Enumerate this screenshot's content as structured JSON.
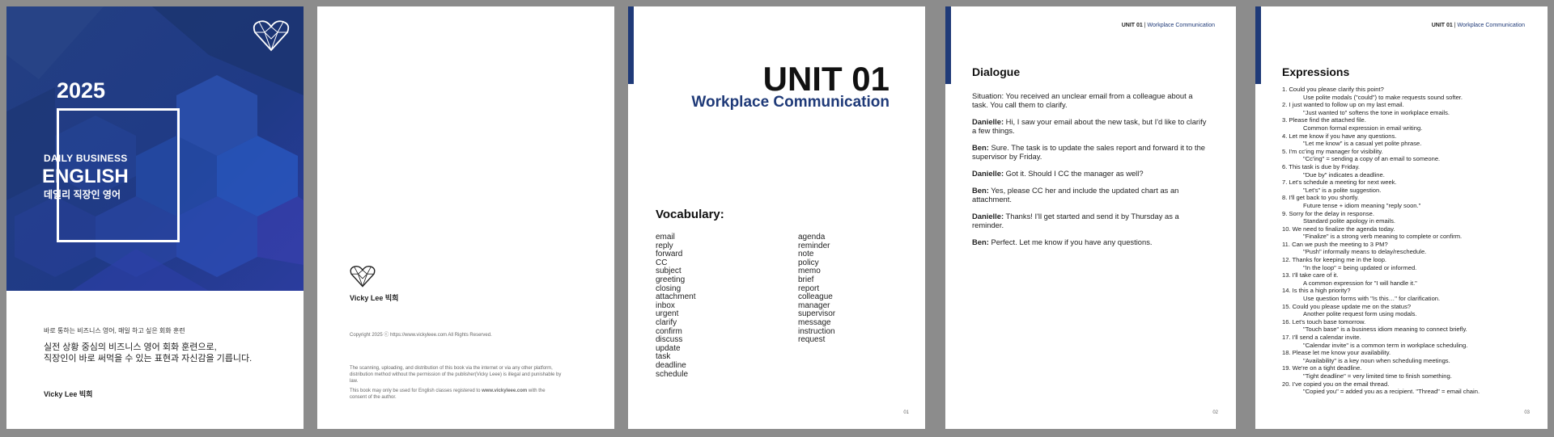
{
  "cover": {
    "year": "2025",
    "subtitle": "DAILY BUSINESS",
    "title": "ENGLISH",
    "title_ko": "데일리 직장인 영어",
    "tagline": "바로 통하는 비즈니스 영어, 매일 하고 싶은 회화 훈련",
    "desc_line1": "실전 상황 중심의 비즈니스 영어 회화 훈련으로,",
    "desc_line2": "직장인이 바로 써먹을 수 있는 표현과 자신감을 기릅니다.",
    "author": "Vicky Lee 빅희",
    "accent": "#1f3a78"
  },
  "copyright_page": {
    "author": "Vicky Lee 빅희",
    "copyright": "Copyright 2025 ⓒ https://www.vickyleee.com All Rights Reserved.",
    "legal": "The scanning, uploading, and distribution of this book via the internet or via any other platform, distribution method without the permission of the publisher(Vicky Leee) is illegal and punishable by law.",
    "note_prefix": "This book may only be used for English classes registered to ",
    "note_site": "www.vickyleee.com",
    "note_suffix": " with the consent of the author."
  },
  "unit_page": {
    "unit": "UNIT 01",
    "subtitle": "Workplace Communication",
    "vocab_heading": "Vocabulary:",
    "vocab_col1": [
      "email",
      "reply",
      "forward",
      "CC",
      "subject",
      "greeting",
      "closing",
      "attachment",
      "inbox",
      "urgent",
      "clarify",
      "confirm",
      "discuss",
      "update",
      "task",
      "deadline",
      "schedule"
    ],
    "vocab_col2": [
      "agenda",
      "reminder",
      "note",
      "policy",
      "memo",
      "brief",
      "report",
      "colleague",
      "manager",
      "supervisor",
      "message",
      "instruction",
      "request"
    ],
    "page_number": "01"
  },
  "dialogue_page": {
    "header_unit": "UNIT 01",
    "header_sep": " | ",
    "header_title": "Workplace Communication",
    "heading": "Dialogue",
    "situation": "Situation: You received an unclear email from a colleague about a task. You call them to clarify.",
    "lines": [
      {
        "speaker": "Danielle:",
        "text": "  Hi, I saw your email about the new task, but I'd like to clarify a few things."
      },
      {
        "speaker": "Ben:",
        "text": " Sure. The task is to update the sales report and forward it to the supervisor by Friday."
      },
      {
        "speaker": "Danielle:",
        "text": " Got it. Should I CC the manager as well?"
      },
      {
        "speaker": "Ben:",
        "text": " Yes, please CC her and include the updated chart as an attachment."
      },
      {
        "speaker": "Danielle:",
        "text": " Thanks! I'll get started and send it by Thursday as a reminder."
      },
      {
        "speaker": "Ben:",
        "text": " Perfect. Let me know if you have any questions."
      }
    ],
    "page_number": "02"
  },
  "expressions_page": {
    "header_unit": "UNIT 01",
    "header_sep": " | ",
    "header_title": "Workplace Communication",
    "heading": "Expressions",
    "items": [
      {
        "phrase": "1. Could you please clarify this point?",
        "expl": "Use polite modals (\"could\") to make requests sound softer."
      },
      {
        "phrase": "2. I just wanted to follow up on my last email.",
        "expl": "\"Just wanted to\" softens the tone in workplace emails."
      },
      {
        "phrase": "3. Please find the attached file.",
        "expl": "Common formal expression in email writing."
      },
      {
        "phrase": "4. Let me know if you have any questions.",
        "expl": "\"Let me know\" is a casual yet polite phrase."
      },
      {
        "phrase": "5. I'm cc'ing my manager for visibility.",
        "expl": "\"Cc'ing\" = sending a copy of an email to someone."
      },
      {
        "phrase": "6. This task is due by Friday.",
        "expl": "\"Due by\" indicates a deadline."
      },
      {
        "phrase": "7. Let's schedule a meeting for next week.",
        "expl": "\"Let's\" is a polite suggestion."
      },
      {
        "phrase": "8. I'll get back to you shortly.",
        "expl": "Future tense + idiom meaning \"reply soon.\""
      },
      {
        "phrase": "9. Sorry for the delay in response.",
        "expl": "Standard polite apology in emails."
      },
      {
        "phrase": "10. We need to finalize the agenda today.",
        "expl": "\"Finalize\" is a strong verb meaning to complete or confirm."
      },
      {
        "phrase": "11. Can we push the meeting to 3 PM?",
        "expl": "\"Push\" informally means to delay/reschedule."
      },
      {
        "phrase": "12. Thanks for keeping me in the loop.",
        "expl": "\"In the loop\" = being updated or informed."
      },
      {
        "phrase": "13. I'll take care of it.",
        "expl": "A common expression for \"I will handle it.\""
      },
      {
        "phrase": "14. Is this a high priority?",
        "expl": "Use question forms with \"Is this…\" for clarification."
      },
      {
        "phrase": "15. Could you please update me on the status?",
        "expl": "Another polite request form using modals."
      },
      {
        "phrase": "16. Let's touch base tomorrow.",
        "expl": "\"Touch base\" is a business idiom meaning to connect briefly."
      },
      {
        "phrase": "17. I'll send a calendar invite.",
        "expl": "\"Calendar invite\" is a common term in workplace scheduling."
      },
      {
        "phrase": "18. Please let me know your availability.",
        "expl": "\"Availability\" is a key noun when scheduling meetings."
      },
      {
        "phrase": "19. We're on a tight deadline.",
        "expl": "\"Tight deadline\" = very limited time to finish something."
      },
      {
        "phrase": "20. I've copied you on the email thread.",
        "expl": "\"Copied you\" = added you as a recipient. \"Thread\" = email chain."
      }
    ],
    "page_number": "03"
  }
}
